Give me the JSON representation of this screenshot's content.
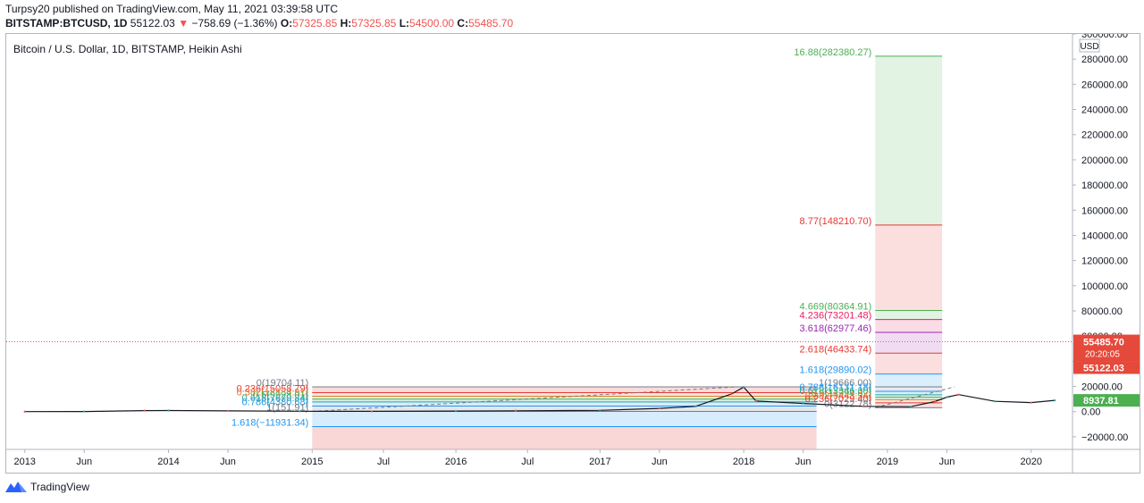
{
  "header": {
    "line1": "Turpsy20 published on TradingView.com, May 11, 2021 03:39:58 UTC",
    "symbol": "BITSTAMP:BTCUSD, 1D",
    "last": "55122.03",
    "change": "−758.69 (−1.36%)",
    "o_label": "O:",
    "o_value": "57325.85",
    "h_label": "H:",
    "h_value": "57325.85",
    "l_label": "L:",
    "l_value": "54500.00",
    "c_label": "C:",
    "c_value": "55485.70"
  },
  "footer": {
    "brand": "TradingView"
  },
  "colors": {
    "down": "#ef5350",
    "up": "#26a69a",
    "fib_blue": "#2196f3",
    "fib_green": "#4caf50",
    "fib_red": "#e53935",
    "fib_purple": "#9c27b0",
    "price_bg_red": "#e5493b",
    "price_bg_green": "#4caf50"
  },
  "chart_data": {
    "type": "line",
    "title": "Bitcoin / U.S. Dollar, 1D, BITSTAMP, Heikin Ashi",
    "currency": "USD",
    "ylim": [
      -30000,
      300000
    ],
    "x_ticks": [
      "2013",
      "Jun",
      "2014",
      "Jun",
      "2015",
      "Jul",
      "2016",
      "Jul",
      "2017",
      "Jun",
      "2018",
      "Jun",
      "2019",
      "Jun",
      "2020"
    ],
    "y_ticks": [
      "300000.00",
      "280000.00",
      "260000.00",
      "240000.00",
      "220000.00",
      "200000.00",
      "180000.00",
      "160000.00",
      "140000.00",
      "120000.00",
      "100000.00",
      "80000.00",
      "60000.00",
      "40000.00",
      "20000.00",
      "0.00",
      "−20000.00"
    ],
    "y_tick_values": [
      300000,
      280000,
      260000,
      240000,
      220000,
      200000,
      180000,
      160000,
      140000,
      120000,
      100000,
      80000,
      60000,
      40000,
      20000,
      0,
      -20000
    ],
    "series": [
      {
        "x": [
          "2013-01",
          "2013-06",
          "2013-11",
          "2014-01",
          "2014-06",
          "2014-12",
          "2015-06",
          "2016-01",
          "2016-06",
          "2017-01",
          "2017-06",
          "2017-09",
          "2017-12",
          "2018-01",
          "2018-02",
          "2018-06",
          "2018-11",
          "2019-03",
          "2019-05",
          "2019-06",
          "2019-07",
          "2019-10",
          "2020-01",
          "2020-03"
        ],
        "y": [
          15,
          100,
          800,
          900,
          600,
          320,
          230,
          430,
          670,
          980,
          2600,
          4200,
          14000,
          19500,
          8500,
          6500,
          4200,
          3900,
          8000,
          11500,
          13500,
          8200,
          7200,
          8937.81
        ]
      }
    ],
    "fib_levels_left": [
      {
        "label": "0(19704.11)",
        "value": 19704,
        "color": "#787b86"
      },
      {
        "label": "0.236(15058.79)",
        "value": 15059,
        "color": "#e53935"
      },
      {
        "label": "0.382(12184.91)",
        "value": 12185,
        "color": "#e57b2c"
      },
      {
        "label": "0.5(9928.01)",
        "value": 9928,
        "color": "#4caf50"
      },
      {
        "label": "0.618(7670.84)",
        "value": 7671,
        "color": "#26a69a"
      },
      {
        "label": "0.786(4380.68)",
        "value": 4381,
        "color": "#2196f3"
      },
      {
        "label": "1(151.91)",
        "value": 152,
        "color": "#787b86"
      },
      {
        "label": "1.618(−11931.34)",
        "value": -11931,
        "color": "#2196f3"
      }
    ],
    "fib_levels_right": [
      {
        "label": "16.88(282380.27)",
        "value": 282380,
        "color": "#4caf50"
      },
      {
        "label": "8.77(148210.70)",
        "value": 148211,
        "color": "#e53935"
      },
      {
        "label": "4.669(80364.91)",
        "value": 80365,
        "color": "#4caf50"
      },
      {
        "label": "4.236(73201.48)",
        "value": 73201,
        "color": "#e91e63"
      },
      {
        "label": "3.618(62977.46)",
        "value": 62977,
        "color": "#9c27b0"
      },
      {
        "label": "2.618(46433.74)",
        "value": 46434,
        "color": "#e53935"
      },
      {
        "label": "1.618(29890.02)",
        "value": 29890,
        "color": "#2196f3"
      },
      {
        "label": "1(19666.00)",
        "value": 19666,
        "color": "#787b86"
      },
      {
        "label": "0.786(16131.18)",
        "value": 16131,
        "color": "#2196f3"
      },
      {
        "label": "0.618(13346.30)",
        "value": 13346,
        "color": "#26a69a"
      },
      {
        "label": "0.5(11394.82)",
        "value": 11395,
        "color": "#4caf50"
      },
      {
        "label": "0.382(9443.34)",
        "value": 9443,
        "color": "#e57b2c"
      },
      {
        "label": "0.236(7029.40)",
        "value": 7029,
        "color": "#e53935"
      },
      {
        "label": "0(3122.78)",
        "value": 3123,
        "color": "#787b86"
      }
    ],
    "price_labels": {
      "last": "55485.70",
      "countdown": "20:20:05",
      "prev": "55122.03",
      "right_end": "8937.81"
    }
  }
}
